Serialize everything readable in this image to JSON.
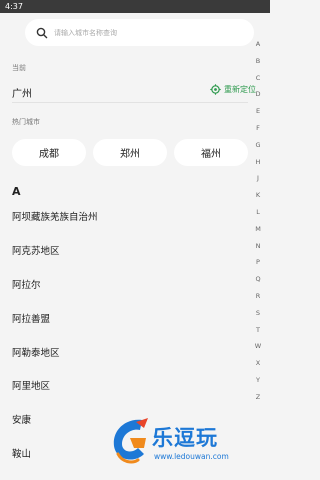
{
  "status_bar": {
    "time": "4:37"
  },
  "search": {
    "placeholder": "请输入城市名称查询"
  },
  "current": {
    "label": "当前",
    "city": "广州",
    "relocate_label": "重新定位"
  },
  "hot": {
    "label": "热门城市",
    "cities": [
      "成都",
      "郑州",
      "福州"
    ]
  },
  "list": {
    "letter": "A",
    "cities": [
      "阿坝藏族羌族自治州",
      "阿克苏地区",
      "阿拉尔",
      "阿拉善盟",
      "阿勒泰地区",
      "阿里地区",
      "安康",
      "鞍山"
    ]
  },
  "index_letters": [
    "A",
    "B",
    "C",
    "D",
    "E",
    "F",
    "G",
    "H",
    "J",
    "K",
    "L",
    "M",
    "N",
    "P",
    "Q",
    "R",
    "S",
    "T",
    "W",
    "X",
    "Y",
    "Z"
  ],
  "watermark": {
    "title": "乐逗玩",
    "url": "www.ledouwan.com"
  },
  "colors": {
    "accent_green": "#2e9a4e",
    "watermark_blue": "#1d78d6"
  }
}
